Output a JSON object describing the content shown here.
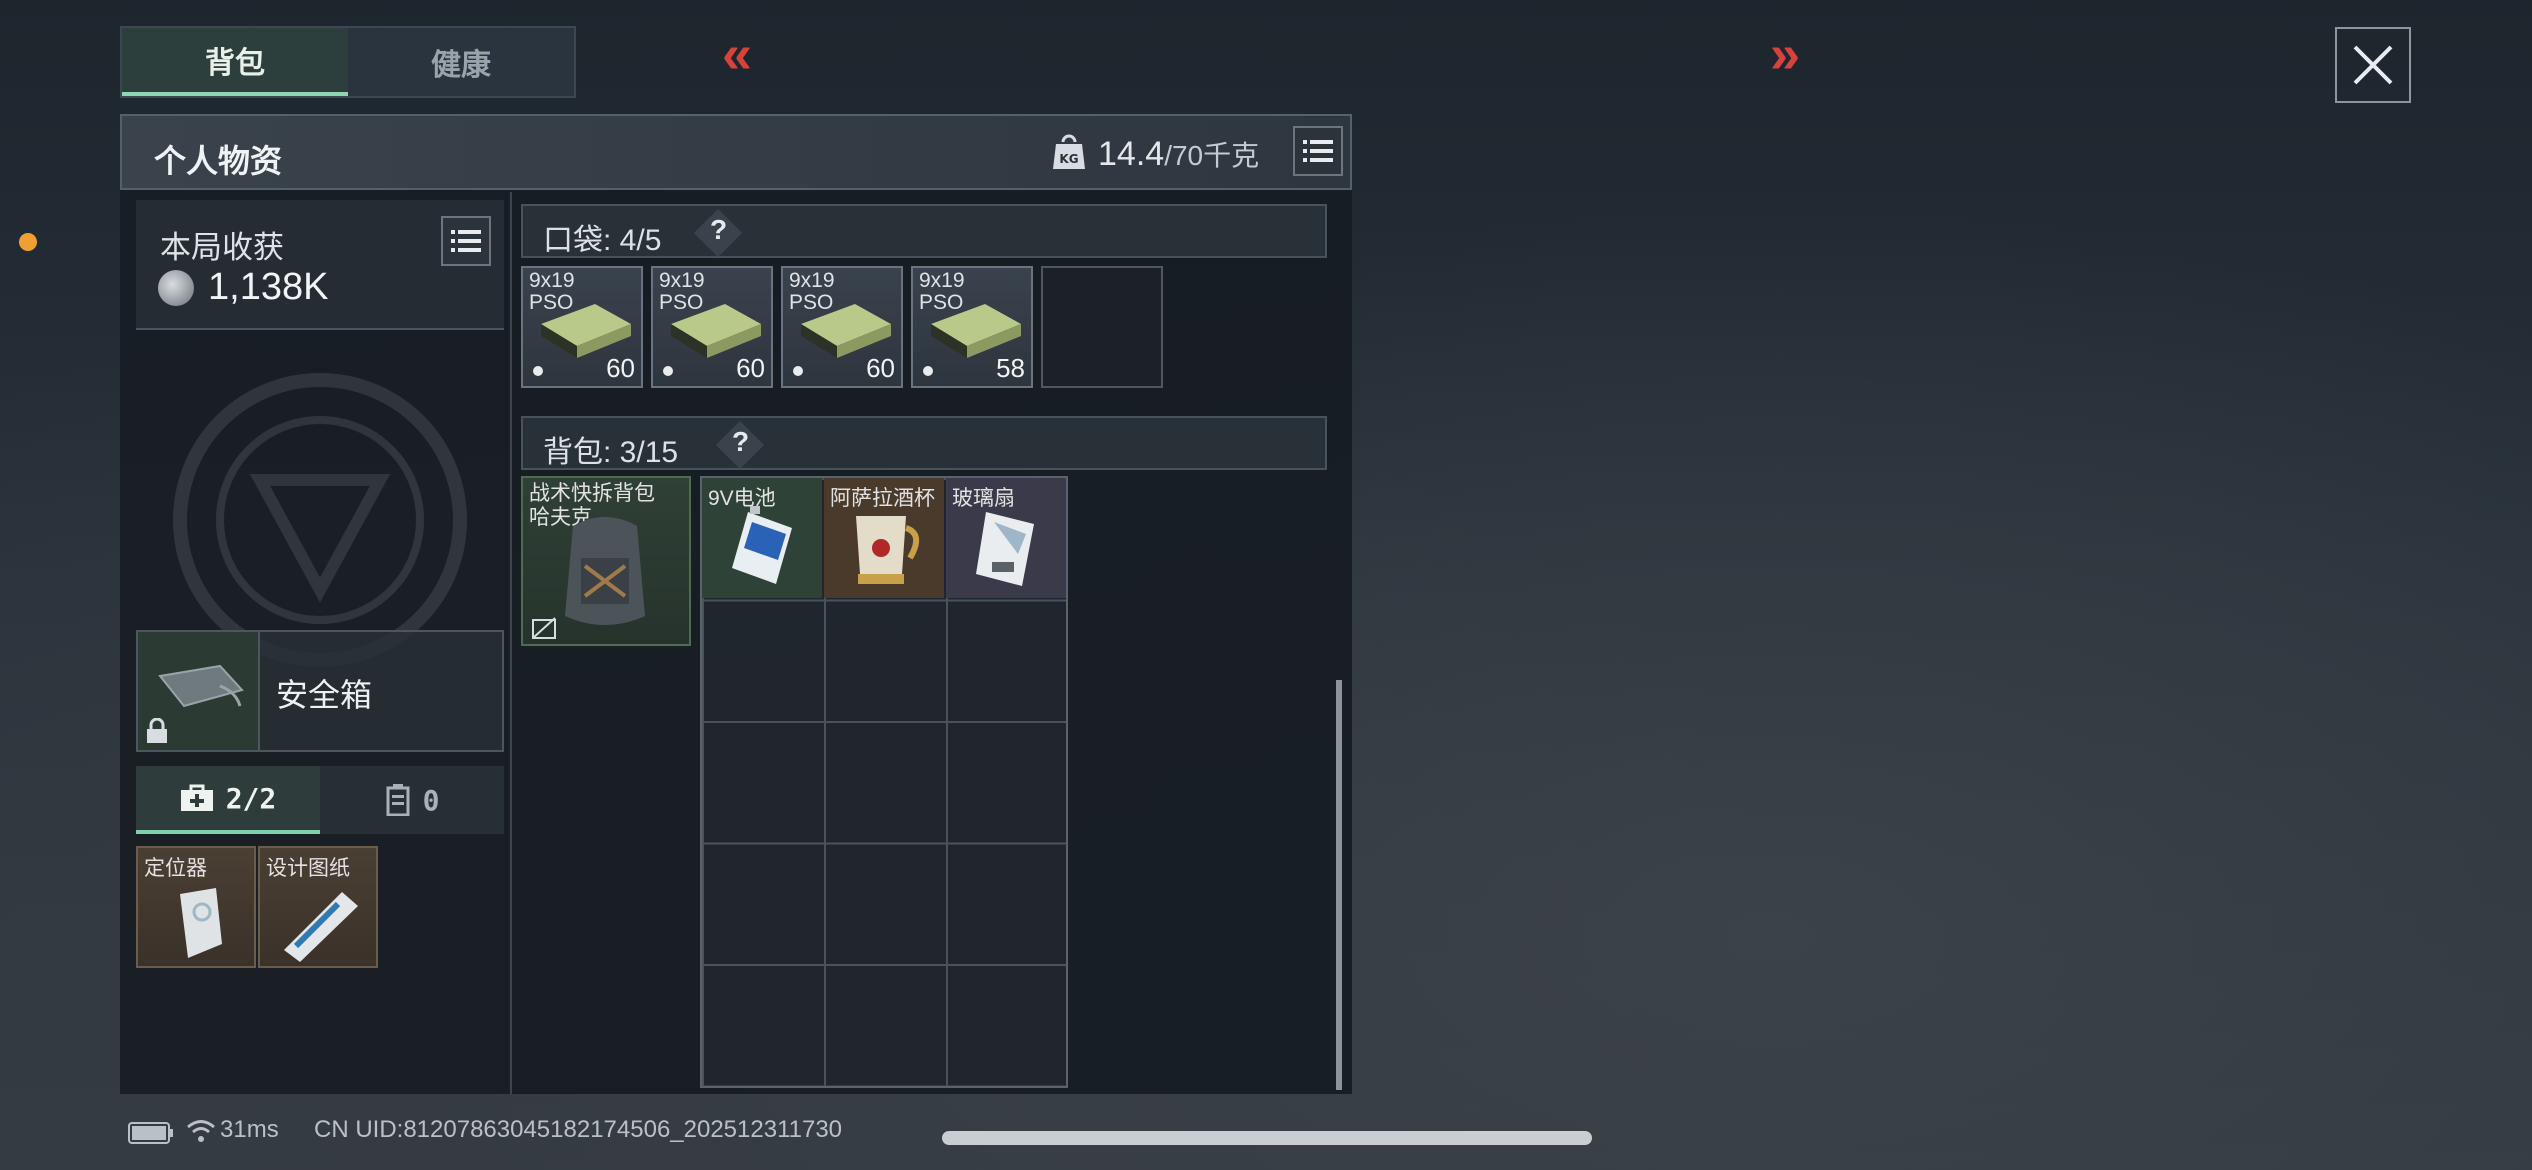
{
  "tabs": [
    {
      "label": "背包",
      "active": true
    },
    {
      "label": "健康",
      "active": false
    }
  ],
  "nav": {
    "prev": "«",
    "next": "»"
  },
  "panel": {
    "title": "个人物资",
    "weight_current": "14.4",
    "weight_max": "/70千克"
  },
  "loot": {
    "label": "本局收获",
    "value": "1,138K"
  },
  "pocket": {
    "label": "口袋: 4/5",
    "help": "?",
    "items": [
      {
        "name": "9x19 PSO",
        "count": "60"
      },
      {
        "name": "9x19 PSO",
        "count": "60"
      },
      {
        "name": "9x19 PSO",
        "count": "60"
      },
      {
        "name": "9x19 PSO",
        "count": "58"
      }
    ]
  },
  "backpack": {
    "label": "背包: 3/15",
    "help": "?",
    "equipped": "战术快拆背包 哈夫克",
    "items": [
      {
        "name": "9V电池",
        "bg": "#2f4238"
      },
      {
        "name": "阿萨拉酒杯",
        "bg": "#4a3a2b"
      },
      {
        "name": "玻璃扇",
        "bg": "#3a3a4a"
      }
    ]
  },
  "safebox": {
    "label": "安全箱"
  },
  "sub_tabs": [
    {
      "label": "2/2",
      "icon": "medkit-icon",
      "active": true
    },
    {
      "label": "0",
      "icon": "canister-icon",
      "active": false
    }
  ],
  "secure_items": [
    {
      "name": "定位器"
    },
    {
      "name": "设计图纸"
    }
  ],
  "status": {
    "ping": "31ms",
    "uid": "CN UID:8120786304518217​4506_202512311730"
  }
}
